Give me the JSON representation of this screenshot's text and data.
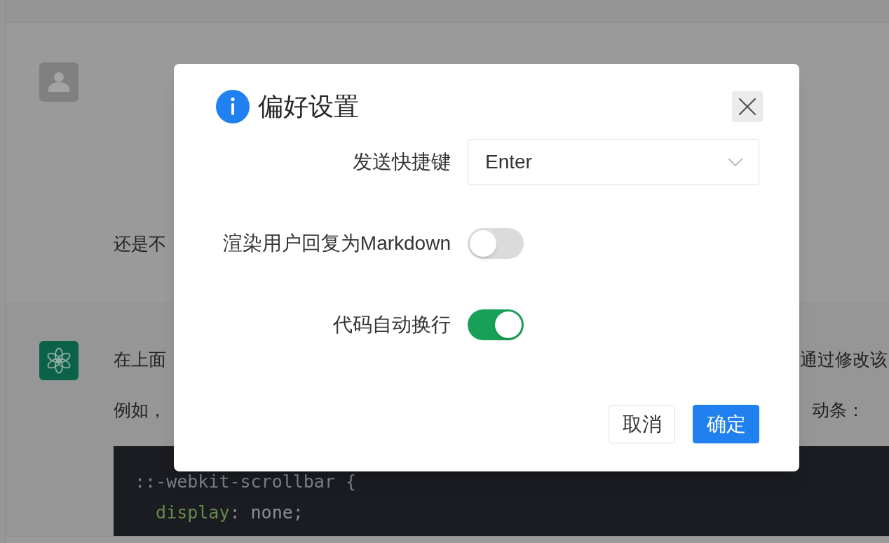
{
  "chat": {
    "messages": [
      {
        "kind": "user",
        "paragraphs": [
          {
            "visible_parts": [
              "还是不"
            ]
          }
        ]
      },
      {
        "kind": "assistant",
        "paragraphs": [
          {
            "visible_parts": [
              "在上面",
              "通过修改该"
            ]
          },
          {
            "visible_parts": [
              "例如，",
              "动条："
            ]
          }
        ],
        "code_block": {
          "lines": [
            {
              "tokens": [
                {
                  "kind": "selector",
                  "text": "::-webkit-scrollbar {"
                }
              ]
            },
            {
              "tokens": [
                {
                  "kind": "property",
                  "text": "  display"
                },
                {
                  "kind": "plain",
                  "text": ": none;"
                }
              ]
            }
          ]
        }
      }
    ]
  },
  "dialog": {
    "title": "偏好设置",
    "fields": [
      {
        "kind": "select",
        "label": "发送快捷键",
        "value": "Enter"
      },
      {
        "kind": "switch",
        "label": "渲染用户回复为Markdown",
        "on": false
      },
      {
        "kind": "switch",
        "label": "代码自动换行",
        "on": true
      }
    ],
    "buttons": [
      {
        "kind": "secondary",
        "label": "取消"
      },
      {
        "kind": "primary",
        "label": "确定"
      }
    ]
  }
}
